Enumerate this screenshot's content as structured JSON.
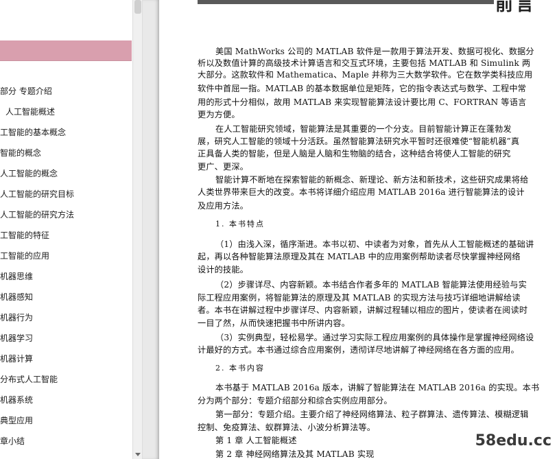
{
  "sidebar": {
    "items": [
      "部分  专题介绍",
      "人工智能概述",
      "工智能的基本概念",
      "智能的概念",
      "人工智能的概念",
      "人工智能的研究目标",
      "人工智能的研究方法",
      "工智能的特征",
      "工智能的应用",
      "机器思维",
      "机器感知",
      "机器行为",
      "机器学习",
      "机器计算",
      "分布式人工智能",
      "机器系统",
      "典型应用",
      "章小结"
    ]
  },
  "page": {
    "header_title": "前言",
    "lines": [
      "美国 MathWorks 公司的 MATLAB 软件是一款用于算法开发、数据可视化、数据分",
      "析以及数值计算的高级技术计算语言和交互式环境，主要包括 MATLAB 和 Simulink 两",
      "大部分。这款软件和 Mathematica、Maple 并称为三大数学软件。它在数学类科技应用",
      "软件中首屈一指。MATLAB 的基本数据单位是矩阵，它的指令表达式与数学、工程中常",
      "用的形式十分相似，故用 MATLAB 来实现智能算法设计要比用 C、FORTRAN 等语言",
      "更为方便。",
      "在人工智能研究领域，智能算法是其重要的一个分支。目前智能计算正在蓬勃发",
      "展，研究人工智能的领域十分活跃。虽然智能算法研究水平暂时还很难使“智能机器”真",
      "正具备人类的智能，但是人脑是人脑和生物脑的结合，这种结合将使人工智能的研究",
      "更广、更深。",
      "智能计算不断地在探索智能的新概念、新理论、新方法和新技术，这些研究成果将给",
      "人类世界带来巨大的改变。本书将详细介绍应用 MATLAB 2016a 进行智能算法的设计",
      "及应用方法。",
      "1. 本书特点",
      "（1）由浅入深，循序渐进。本书以初、中读者为对象，首先从人工智能概述的基础讲",
      "起，再以各种智能算法原理及其在 MATLAB 中的应用案例帮助读者尽快掌握神经网络",
      "设计的技能。",
      "（2）步骤详尽、内容新颖。本书结合作者多年的 MATLAB 智能算法使用经验与实",
      "际工程应用案例，将智能算法的原理及其 MATLAB 的实现方法与技巧详细地讲解给读",
      "者。本书在讲解过程中步骤详尽、内容新颖，讲解过程辅以相应的图片，使读者在阅读时",
      "一目了然，从而快速把握书中所讲内容。",
      "（3）实例典型，轻松易学。通过学习实际工程应用案例的具体操作是掌握神经网络设",
      "计最好的方式。本书通过综合应用案例，透彻详尽地讲解了神经网络在各方面的应用。",
      "2. 本书内容",
      "本书基于 MATLAB 2016a 版本，讲解了智能算法在 MATLAB 2016a 的实现。本书",
      "分为两个部分：专题介绍部分和综合实例应用部分。",
      "第一部分：专题介绍。主要介绍了神经网络算法、粒子群算法、遗传算法、模糊逻辑",
      "控制、免疫算法、蚁群算法、小波分析算法等。",
      "第 1 章   人工智能概述",
      "第 2 章   神经网络算法及其 MATLAB 实现"
    ]
  },
  "watermark": "58edu.cc"
}
